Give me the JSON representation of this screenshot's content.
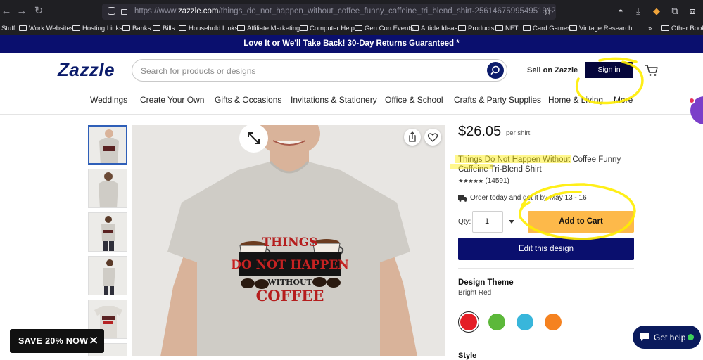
{
  "browser": {
    "url_prefix": "https://www.",
    "url_domain": "zazzle.com",
    "url_path": "/things_do_not_happen_without_coffee_funny_caffeine_tri_blend_shirt-256146759954951912",
    "bookmarks": [
      "Stuff",
      "Work Websites",
      "Hosting Links",
      "Banks",
      "Bills",
      "Household Links",
      "Affiliate Marketing",
      "Computer Help",
      "Gen Con Events",
      "Article Ideas",
      "Products",
      "NFT",
      "Card Games",
      "Vintage Research"
    ],
    "bookmarks_more": "»",
    "other_bookmarks": "Other Bookm"
  },
  "promo": {
    "text": "Love It or We'll Take Back!   30-Day Returns Guaranteed *"
  },
  "header": {
    "logo": "Zazzle",
    "search_placeholder": "Search for products or designs",
    "sell_link": "Sell on Zazzle",
    "signin_label": "Sign in"
  },
  "categories": [
    "Weddings",
    "Create Your Own",
    "Gifts & Occasions",
    "Invitations & Stationery",
    "Office & School",
    "Crafts & Party Supplies",
    "Home & Living",
    "More"
  ],
  "product": {
    "price": "$26.05",
    "price_unit": "per shirt",
    "title": "Things Do Not Happen Without Coffee Funny Caffeine Tri-Blend Shirt",
    "stars": "★★★★★",
    "review_count": "(14591)",
    "rating_stars": 4.5,
    "delivery": "Order today and get it by May 13 - 16",
    "qty_label": "Qty:",
    "qty_value": "1",
    "add_to_cart": "Add to Cart",
    "edit_design": "Edit this design",
    "design_theme_heading": "Design Theme",
    "design_theme_value": "Bright Red",
    "swatch_colors": [
      "#e41e26",
      "#5cb83a",
      "#38b6db",
      "#f58220"
    ],
    "style_heading": "Style",
    "shirt_print_lines": [
      "THINGS",
      "DO NOT HAPPEN",
      "WITHOUT",
      "COFFEE"
    ]
  },
  "overlays": {
    "save_banner": "SAVE 20% NOW",
    "help_button": "Get help"
  },
  "colors": {
    "navy": "#0a0f6e",
    "cta_yellow": "#fdb94a",
    "highlight": "#ffee00"
  }
}
